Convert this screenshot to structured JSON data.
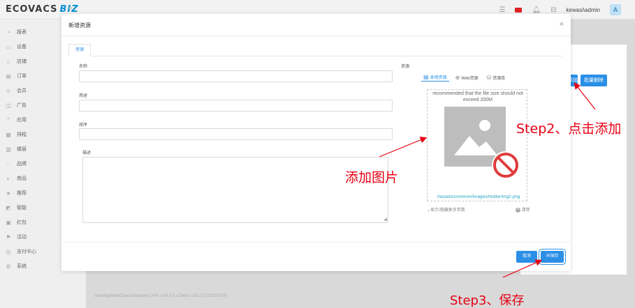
{
  "app": {
    "logo_text": "ECOVACS",
    "logo_suffix": "BIZ",
    "collapse_icon": "double-chevron-left"
  },
  "topbar": {
    "user": "kewasi\\admin",
    "avatar": "A"
  },
  "sidebar": {
    "items": [
      {
        "label": "报表",
        "icon": "chart-icon"
      },
      {
        "label": "设备",
        "icon": "device-icon"
      },
      {
        "label": "店铺",
        "icon": "store-icon"
      },
      {
        "label": "订单",
        "icon": "order-icon"
      },
      {
        "label": "会员",
        "icon": "member-icon"
      },
      {
        "label": "广告",
        "icon": "ad-icon"
      },
      {
        "label": "应用",
        "icon": "app-icon"
      },
      {
        "label": "排程",
        "icon": "schedule-icon"
      },
      {
        "label": "楼层",
        "icon": "floor-icon"
      },
      {
        "label": "品牌",
        "icon": "brand-icon"
      },
      {
        "label": "商品",
        "icon": "goods-icon"
      },
      {
        "label": "推荐",
        "icon": "star-icon"
      },
      {
        "label": "智能",
        "icon": "smart-icon"
      },
      {
        "label": "红包",
        "icon": "redpacket-icon"
      },
      {
        "label": "活动",
        "icon": "activity-icon"
      },
      {
        "label": "支付中心",
        "icon": "pay-icon"
      },
      {
        "label": "系统",
        "icon": "system-icon"
      }
    ]
  },
  "background": {
    "add_btn": "添加",
    "batch_delete": "批量删除",
    "footer": "SensingStoreCloud Standard | API: v10.2.0 | Client: v10.2.0 [20210716]"
  },
  "modal": {
    "title": "新增资源",
    "tab": "资源",
    "fields": {
      "name": "名称",
      "usage": "用途",
      "order": "排序",
      "desc": "描述",
      "resource": "资源"
    },
    "resource_tabs": {
      "local": "本地资源",
      "web": "Web资源",
      "library": "资源库"
    },
    "image_note": "recommended that the file size should not exceed 200M",
    "image_path": "//assets/common/images/holderImg2.png",
    "more_params": "显示/隐藏更多参数",
    "clear": "清除",
    "cancel": "取消",
    "save": "保存"
  },
  "annotations": {
    "step2": "Step2、点击添加",
    "add_image": "添加图片",
    "step3": "Step3、保存"
  },
  "colors": {
    "primary": "#2b8fe6",
    "annotation": "#e60012",
    "path": "#1fa3bd"
  }
}
